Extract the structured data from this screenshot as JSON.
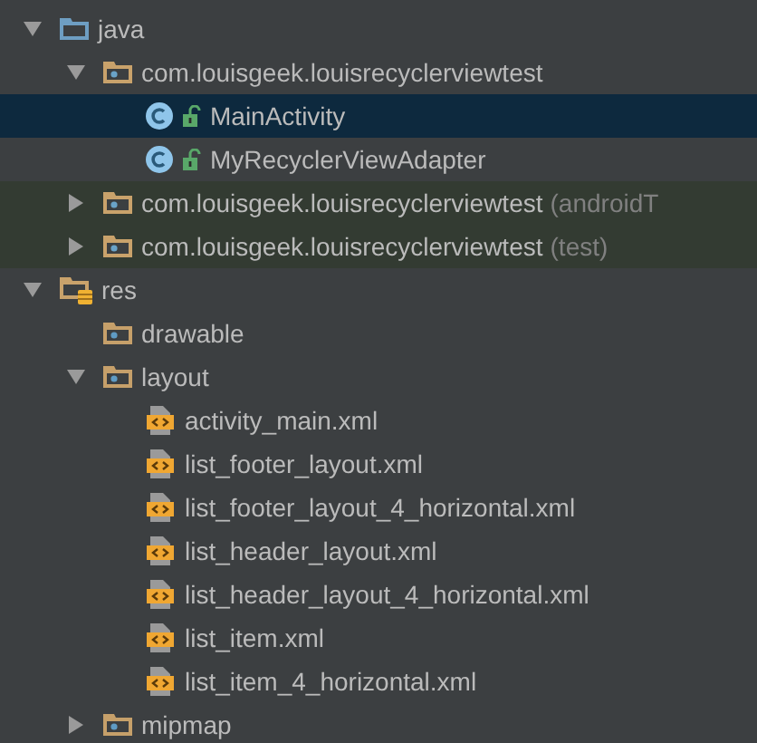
{
  "tree": [
    {
      "kind": "source_folder",
      "label": "java",
      "expanded": true,
      "selected": false,
      "children": [
        {
          "kind": "package",
          "label": "com.louisgeek.louisrecyclerviewtest",
          "expanded": true,
          "selected": false,
          "test_scope": false,
          "children": [
            {
              "kind": "class",
              "label": "MainActivity",
              "selected": true
            },
            {
              "kind": "class",
              "label": "MyRecyclerViewAdapter",
              "selected": false
            }
          ]
        },
        {
          "kind": "package",
          "label": "com.louisgeek.louisrecyclerviewtest",
          "suffix": "(androidT",
          "expanded": false,
          "selected": false,
          "test_scope": true
        },
        {
          "kind": "package",
          "label": "com.louisgeek.louisrecyclerviewtest",
          "suffix": "(test)",
          "expanded": false,
          "selected": false,
          "test_scope": true
        }
      ]
    },
    {
      "kind": "res_folder",
      "label": "res",
      "expanded": true,
      "selected": false,
      "children": [
        {
          "kind": "folder",
          "label": "drawable",
          "selected": false
        },
        {
          "kind": "folder",
          "label": "layout",
          "expanded": true,
          "selected": false,
          "children": [
            {
              "kind": "xml",
              "label": "activity_main.xml",
              "selected": false
            },
            {
              "kind": "xml",
              "label": "list_footer_layout.xml",
              "selected": false
            },
            {
              "kind": "xml",
              "label": "list_footer_layout_4_horizontal.xml",
              "selected": false
            },
            {
              "kind": "xml",
              "label": "list_header_layout.xml",
              "selected": false
            },
            {
              "kind": "xml",
              "label": "list_header_layout_4_horizontal.xml",
              "selected": false
            },
            {
              "kind": "xml",
              "label": "list_item.xml",
              "selected": false
            },
            {
              "kind": "xml",
              "label": "list_item_4_horizontal.xml",
              "selected": false
            }
          ]
        },
        {
          "kind": "folder",
          "label": "mipmap",
          "expanded": false,
          "selected": false
        }
      ]
    }
  ]
}
